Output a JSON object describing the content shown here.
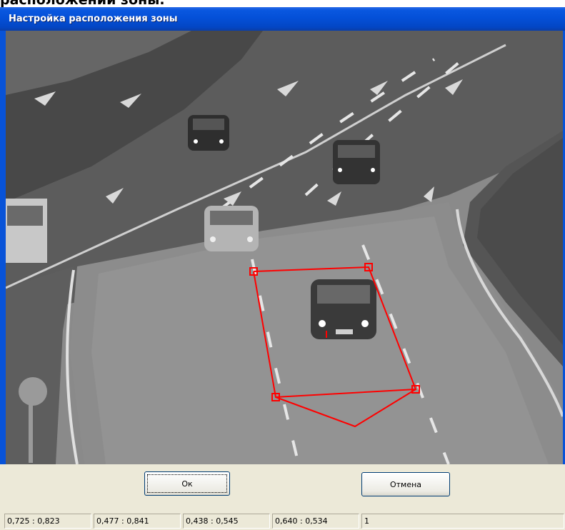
{
  "document": {
    "heading_fragment": "расположении зоны."
  },
  "window": {
    "title": "Настройка расположения зоны"
  },
  "video": {
    "zone_color": "#ff0000"
  },
  "buttons": {
    "ok_label": "Ок",
    "cancel_label": "Отмена"
  },
  "statusbar": {
    "cells": [
      "0,725 : 0,823",
      "0,477 : 0,841",
      "0,438 : 0,545",
      "0,640 : 0,534",
      "1"
    ]
  }
}
